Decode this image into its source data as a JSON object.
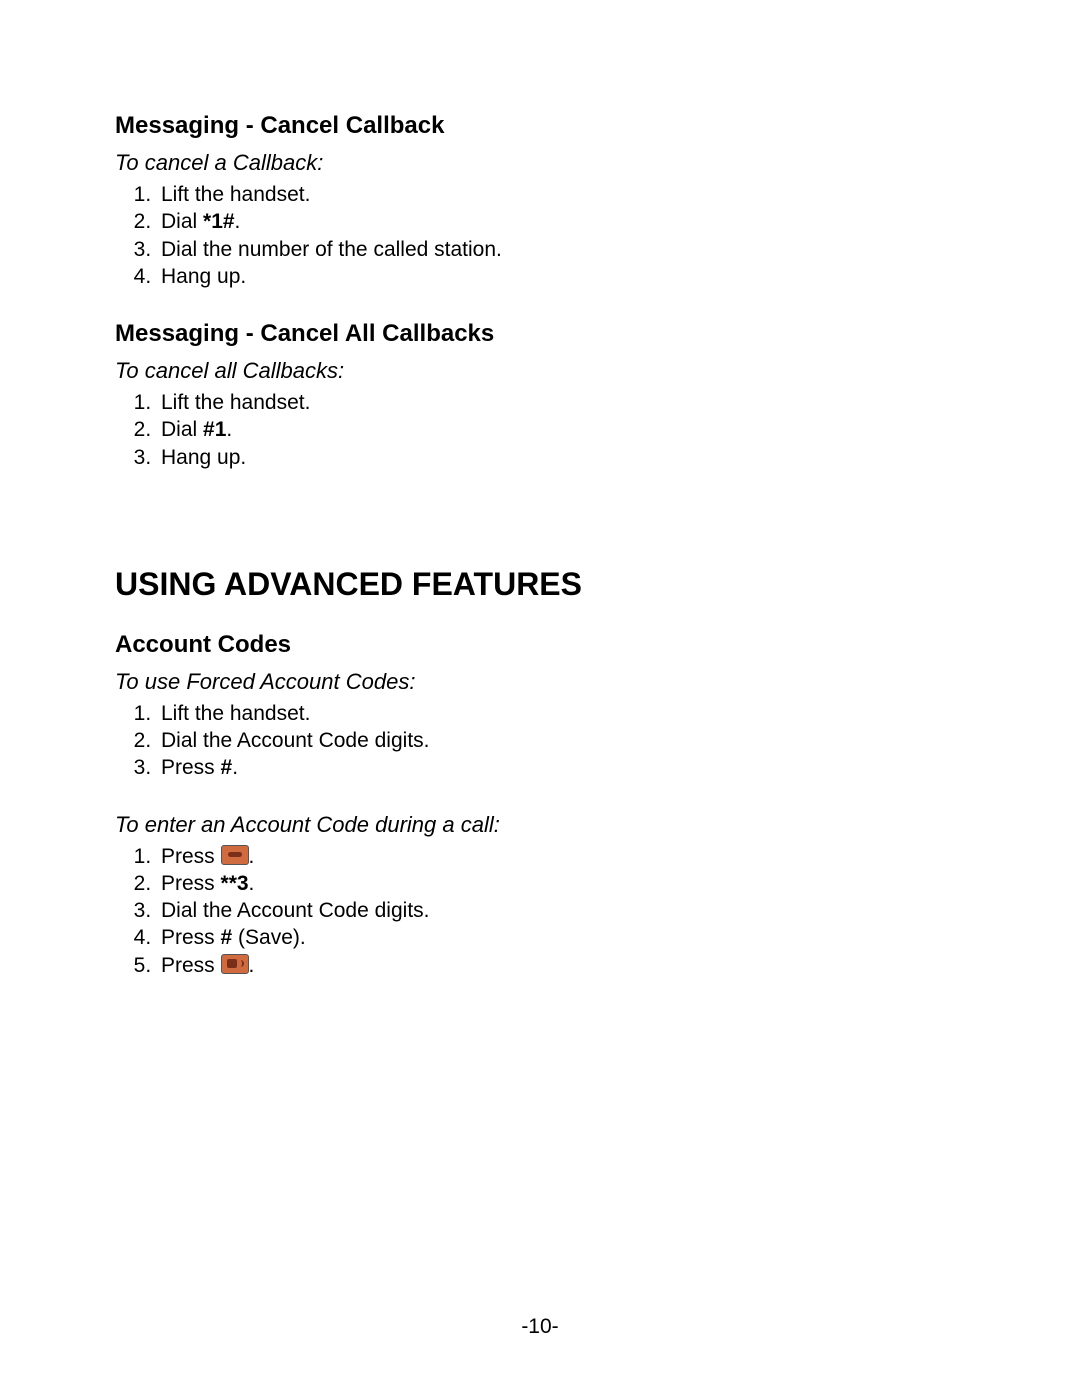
{
  "sections": [
    {
      "heading": "Messaging - Cancel Callback",
      "subheading": "To cancel a Callback:",
      "steps": [
        [
          {
            "t": "Lift the handset."
          }
        ],
        [
          {
            "t": "Dial "
          },
          {
            "t": "*1#",
            "bold": true
          },
          {
            "t": "."
          }
        ],
        [
          {
            "t": "Dial the number of the called station."
          }
        ],
        [
          {
            "t": "Hang up."
          }
        ]
      ]
    },
    {
      "heading": "Messaging - Cancel All Callbacks",
      "subheading": "To cancel all Callbacks:",
      "steps": [
        [
          {
            "t": "Lift the handset."
          }
        ],
        [
          {
            "t": "Dial "
          },
          {
            "t": "#1",
            "bold": true
          },
          {
            "t": "."
          }
        ],
        [
          {
            "t": "Hang up."
          }
        ]
      ]
    }
  ],
  "advanced_title": "USING ADVANCED FEATURES",
  "advanced": {
    "heading": "Account Codes",
    "blocks": [
      {
        "subheading": "To use Forced Account Codes:",
        "steps": [
          [
            {
              "t": "Lift the handset."
            }
          ],
          [
            {
              "t": "Dial the Account Code digits."
            }
          ],
          [
            {
              "t": "Press "
            },
            {
              "t": "#",
              "bold": true
            },
            {
              "t": "."
            }
          ]
        ]
      },
      {
        "subheading": "To enter an Account Code during a call:",
        "steps": [
          [
            {
              "t": "Press "
            },
            {
              "icon": "hook"
            },
            {
              "t": "."
            }
          ],
          [
            {
              "t": "Press "
            },
            {
              "t": "**3",
              "bold": true
            },
            {
              "t": "."
            }
          ],
          [
            {
              "t": "Dial the Account Code digits."
            }
          ],
          [
            {
              "t": "Press "
            },
            {
              "t": "#",
              "bold": true
            },
            {
              "t": " (Save)."
            }
          ],
          [
            {
              "t": "Press "
            },
            {
              "icon": "speaker"
            },
            {
              "t": "."
            }
          ]
        ]
      }
    ]
  },
  "page_number": "-10-"
}
